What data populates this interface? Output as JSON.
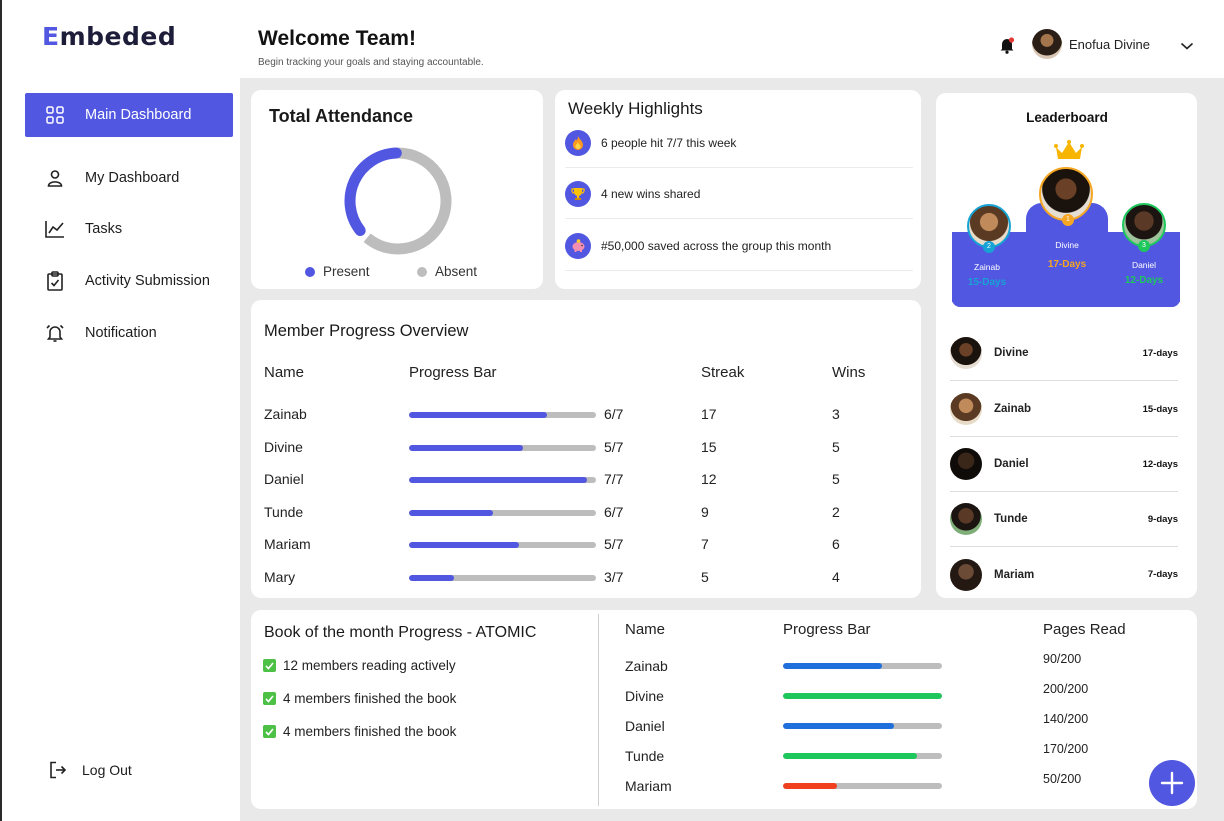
{
  "app": {
    "logo_first": "E",
    "logo_rest": "mbeded"
  },
  "sidebar": {
    "items": [
      {
        "label": "Main Dashboard",
        "icon": "grid-icon",
        "active": true
      },
      {
        "label": "My Dashboard",
        "icon": "user-icon",
        "active": false
      },
      {
        "label": "Tasks",
        "icon": "chart-line-icon",
        "active": false
      },
      {
        "label": "Activity Submission",
        "icon": "clipboard-icon",
        "active": false
      },
      {
        "label": "Notification",
        "icon": "alarm-icon",
        "active": false
      }
    ],
    "logout_label": "Log Out"
  },
  "header": {
    "title": "Welcome Team!",
    "subtitle": "Begin tracking your goals  and staying accountable.",
    "user_name": "Enofua Divine"
  },
  "attendance": {
    "title": "Total Attendance",
    "present_label": "Present",
    "absent_label": "Absent",
    "present_fraction": 0.4,
    "colors": {
      "present": "#5157e0",
      "absent": "#bdbdbd"
    }
  },
  "highlights": {
    "title": "Weekly Highlights",
    "items": [
      {
        "text": "6 people hit 7/7 this week",
        "icon": "fire-icon"
      },
      {
        "text": "4 new wins shared",
        "icon": "trophy-icon"
      },
      {
        "text": "#50,000 saved across the group this month",
        "icon": "piggy-bank-icon"
      }
    ]
  },
  "member_progress": {
    "title": "Member Progress Overview",
    "headers": {
      "name": "Name",
      "progress": "Progress Bar",
      "streak": "Streak",
      "wins": "Wins"
    },
    "rows": [
      {
        "name": "Zainab",
        "fraction": 0.74,
        "label": "6/7",
        "streak": "17",
        "wins": "3"
      },
      {
        "name": "Divine",
        "fraction": 0.61,
        "label": "5/7",
        "streak": "15",
        "wins": "5"
      },
      {
        "name": "Daniel",
        "fraction": 0.95,
        "label": "7/7",
        "streak": "12",
        "wins": "5"
      },
      {
        "name": "Tunde",
        "fraction": 0.45,
        "label": "6/7",
        "streak": "9",
        "wins": "2"
      },
      {
        "name": "Mariam",
        "fraction": 0.59,
        "label": "5/7",
        "streak": "7",
        "wins": "6"
      },
      {
        "name": "Mary",
        "fraction": 0.24,
        "label": "3/7",
        "streak": "5",
        "wins": "4"
      }
    ],
    "bar_color": "#5157e0"
  },
  "leaderboard": {
    "title": "Leaderboard",
    "podium": [
      {
        "name": "Zainab",
        "days": "15-Days",
        "rank": "2",
        "color": "#16a2d4"
      },
      {
        "name": "Divine",
        "days": "17-Days",
        "rank": "1",
        "color": "#f5a623"
      },
      {
        "name": "Daniel",
        "days": "12-Days",
        "rank": "3",
        "color": "#1ec75c"
      }
    ],
    "rows": [
      {
        "name": "Divine",
        "days": "17-days"
      },
      {
        "name": "Zainab",
        "days": "15-days"
      },
      {
        "name": "Daniel",
        "days": "12-days"
      },
      {
        "name": "Tunde",
        "days": "9-days"
      },
      {
        "name": "Mariam",
        "days": "7-days"
      }
    ]
  },
  "book": {
    "title": "Book of the month Progress - ATOMIC",
    "items": [
      "12 members reading actively",
      "4 members finished the book",
      "4 members finished the book"
    ],
    "headers": {
      "name": "Name",
      "progress": "Progress Bar",
      "pages": "Pages Read"
    },
    "rows": [
      {
        "name": "Zainab",
        "pages": "90/200",
        "fraction": 0.62,
        "color": "#1f6fdc"
      },
      {
        "name": "Divine",
        "pages": "200/200",
        "fraction": 1.0,
        "color": "#1ec75c"
      },
      {
        "name": "Daniel",
        "pages": "140/200",
        "fraction": 0.7,
        "color": "#1f6fdc"
      },
      {
        "name": "Tunde",
        "pages": "170/200",
        "fraction": 0.84,
        "color": "#1ec75c"
      },
      {
        "name": "Mariam",
        "pages": "50/200",
        "fraction": 0.34,
        "color": "#f0401e"
      }
    ]
  }
}
